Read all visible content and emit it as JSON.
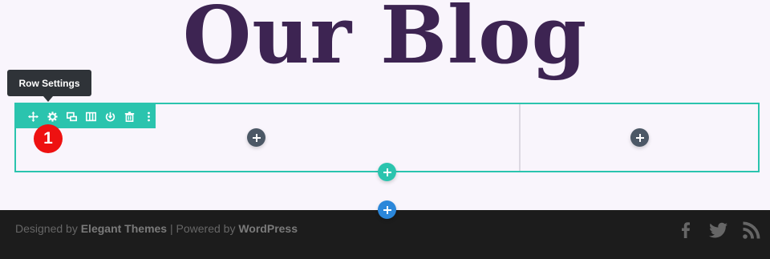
{
  "page": {
    "title": "Our Blog"
  },
  "tooltip": {
    "text": "Row Settings"
  },
  "toolbar": {
    "icons": [
      "move-icon",
      "gear-icon",
      "duplicate-icon",
      "columns-icon",
      "save-icon",
      "trash-icon",
      "more-icon"
    ]
  },
  "annotation": {
    "step_number": "1"
  },
  "footer": {
    "designed_by_prefix": "Designed by",
    "designed_by_name": "Elegant Themes",
    "separator": "|",
    "powered_by_prefix": "Powered by",
    "powered_by_name": "WordPress",
    "social": [
      "facebook-icon",
      "twitter-icon",
      "rss-icon"
    ]
  },
  "colors": {
    "title": "#3d2452",
    "accent_teal": "#2bc4ae",
    "accent_blue": "#2b87da",
    "dark_button": "#4c5866",
    "footer_bg": "#1c1c1c",
    "badge_red": "#ee1111"
  }
}
